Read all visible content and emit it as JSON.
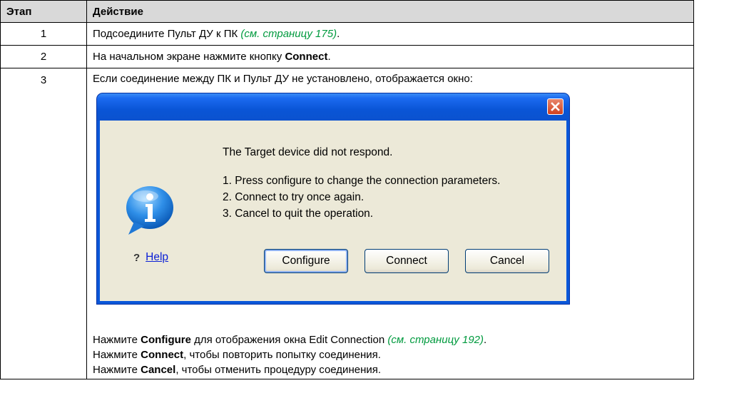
{
  "table": {
    "headers": [
      "Этап",
      "Действие"
    ],
    "rows": [
      {
        "step": "1",
        "pre": "Подсоедините Пульт ДУ к ПК ",
        "xref": "(см. страницу 175)",
        "post": "."
      },
      {
        "step": "2",
        "pre": "На начальном экране нажмите кнопку ",
        "bold": "Connect",
        "post": "."
      },
      {
        "step": "3",
        "intro": "Если соединение между ПК и Пульт ДУ не установлено, отображается окно:"
      }
    ]
  },
  "dialog": {
    "message_title": "The Target device did not respond.",
    "items": [
      "1. Press configure to change the connection parameters.",
      "2. Connect to try once again.",
      "3. Cancel to quit the operation."
    ],
    "help_label": "Help",
    "buttons": [
      "Configure",
      "Connect",
      "Cancel"
    ]
  },
  "notes": [
    {
      "pre": "Нажмите ",
      "bold": "Configure",
      "mid": " для отображения окна Edit Connection ",
      "xref": "(см. страницу 192)",
      "post": "."
    },
    {
      "pre": "Нажмите ",
      "bold": "Connect",
      "mid": ", чтобы повторить попытку соединения."
    },
    {
      "pre": "Нажмите ",
      "bold": "Cancel",
      "mid": ", чтобы отменить процедуру соединения."
    }
  ],
  "colors": {
    "xref": "#009a3e",
    "title_bar": "#0a55d6",
    "dialog_bg": "#ece9d8"
  }
}
